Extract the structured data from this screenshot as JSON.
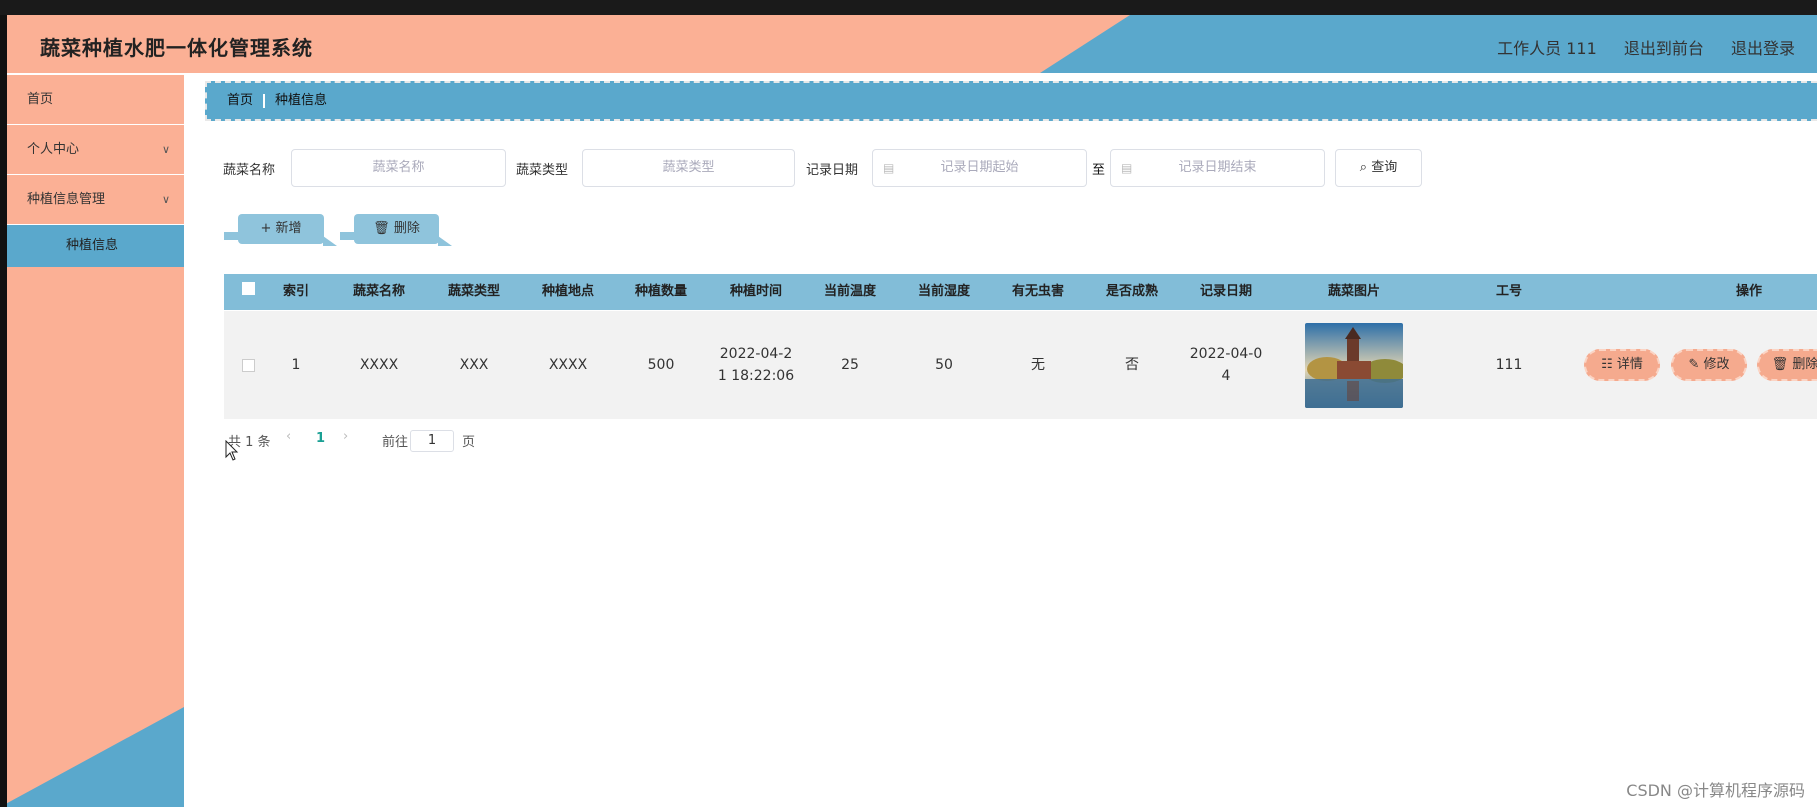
{
  "header": {
    "title": "蔬菜种植水肥一体化管理系统",
    "user": "工作人员 111",
    "exit_front": "退出到前台",
    "exit_login": "退出登录"
  },
  "colors": {
    "salmon": "#fbb095",
    "blue": "#5aa8cc",
    "table_head": "#82bdd8"
  },
  "sidebar": {
    "items": [
      {
        "label": "首页"
      },
      {
        "label": "个人中心"
      },
      {
        "label": "种植信息管理"
      }
    ],
    "sub_active": "种植信息"
  },
  "breadcrumb": {
    "home": "首页",
    "current": "种植信息"
  },
  "filters": {
    "name_label": "蔬菜名称",
    "name_placeholder": "蔬菜名称",
    "type_label": "蔬菜类型",
    "type_placeholder": "蔬菜类型",
    "date_label": "记录日期",
    "date_start": "记录日期起始",
    "date_to": "至",
    "date_end": "记录日期结束",
    "query": "查询"
  },
  "actions": {
    "add": "新增",
    "delete": "删除"
  },
  "table": {
    "columns": [
      "索引",
      "蔬菜名称",
      "蔬菜类型",
      "种植地点",
      "种植数量",
      "种植时间",
      "当前温度",
      "当前湿度",
      "有无虫害",
      "是否成熟",
      "记录日期",
      "蔬菜图片",
      "工号",
      "操作"
    ],
    "row": {
      "index": "1",
      "name": "XXXX",
      "type": "XXX",
      "place": "XXXX",
      "count": "500",
      "plant_time_1": "2022-04-2",
      "plant_time_2": "1 18:22:06",
      "temp": "25",
      "humidity": "50",
      "pest": "无",
      "mature": "否",
      "date_1": "2022-04-0",
      "date_2": "4",
      "worker_id": "111",
      "ops": {
        "detail": "详情",
        "edit": "修改",
        "delete": "删除"
      }
    }
  },
  "pager": {
    "total": "共 1 条",
    "current_page": "1",
    "goto": "前往",
    "page_input": "1",
    "page_unit": "页"
  },
  "watermark": "CSDN @计算机程序源码"
}
